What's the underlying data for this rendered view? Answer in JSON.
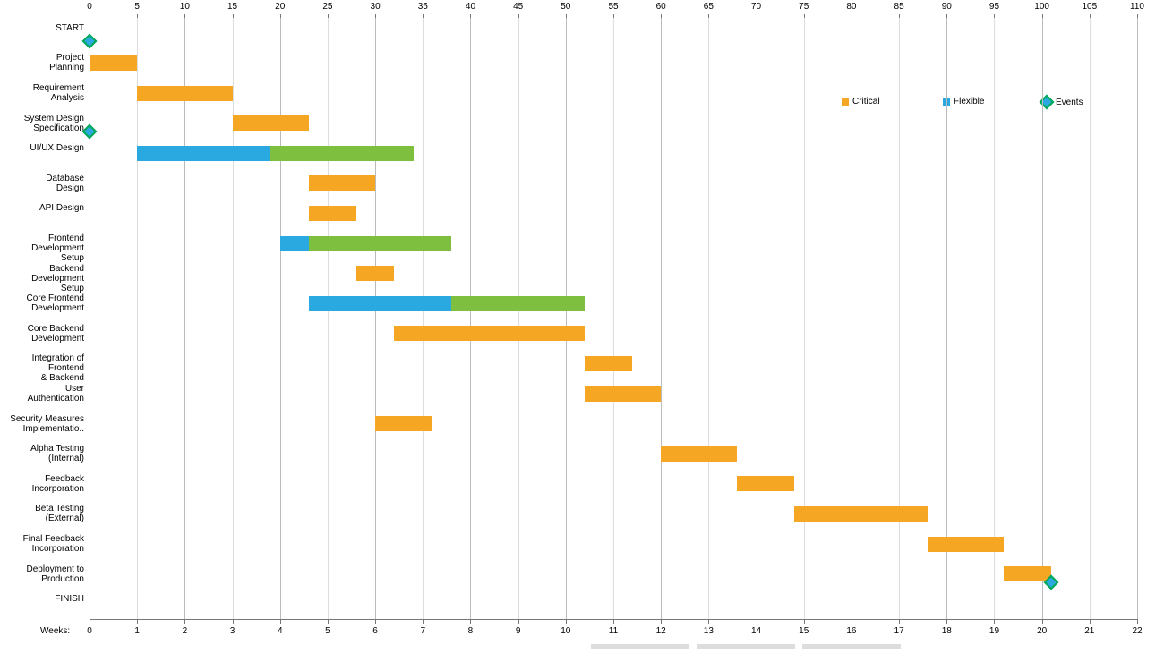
{
  "chart_data": {
    "type": "gantt",
    "top_axis": {
      "label_suffix": "",
      "min": 0,
      "max": 110,
      "step": 5
    },
    "bottom_axis": {
      "label": "Weeks:",
      "min": 0,
      "max": 22,
      "step": 1
    },
    "legend": [
      {
        "name": "Critical",
        "color": "#f5a623",
        "shape": "square"
      },
      {
        "name": "Flexible",
        "color": "#2aa9e0",
        "shape": "square"
      },
      {
        "name": "Events",
        "color": "#2aa9e0",
        "shape": "diamond"
      }
    ],
    "tasks": [
      {
        "label": "START",
        "segments": [],
        "events": [
          {
            "at": 0
          }
        ]
      },
      {
        "label": "Project Planning",
        "segments": [
          {
            "start": 0,
            "end": 5,
            "kind": "critical"
          }
        ]
      },
      {
        "label": "Requirement Analysis",
        "segments": [
          {
            "start": 5,
            "end": 15,
            "kind": "critical"
          }
        ]
      },
      {
        "label": "System Design Specification",
        "segments": [
          {
            "start": 15,
            "end": 23,
            "kind": "critical"
          }
        ],
        "events": [
          {
            "at": 0
          }
        ]
      },
      {
        "label": "UI/UX Design",
        "segments": [
          {
            "start": 5,
            "end": 19,
            "kind": "flexible"
          },
          {
            "start": 19,
            "end": 34,
            "kind": "slack"
          }
        ]
      },
      {
        "label": "Database Design",
        "segments": [
          {
            "start": 23,
            "end": 30,
            "kind": "critical"
          }
        ]
      },
      {
        "label": "API Design",
        "segments": [
          {
            "start": 23,
            "end": 28,
            "kind": "critical"
          }
        ]
      },
      {
        "label": "Frontend Development Setup",
        "segments": [
          {
            "start": 20,
            "end": 23,
            "kind": "flexible"
          },
          {
            "start": 23,
            "end": 38,
            "kind": "slack"
          }
        ]
      },
      {
        "label": "Backend Development Setup",
        "segments": [
          {
            "start": 28,
            "end": 32,
            "kind": "critical"
          }
        ]
      },
      {
        "label": "Core Frontend Development",
        "segments": [
          {
            "start": 23,
            "end": 38,
            "kind": "flexible"
          },
          {
            "start": 38,
            "end": 52,
            "kind": "slack"
          }
        ]
      },
      {
        "label": "Core Backend Development",
        "segments": [
          {
            "start": 32,
            "end": 52,
            "kind": "critical"
          }
        ]
      },
      {
        "label": "Integration of Frontend & Backend",
        "segments": [
          {
            "start": 52,
            "end": 57,
            "kind": "critical"
          }
        ]
      },
      {
        "label": "User Authentication",
        "segments": [
          {
            "start": 52,
            "end": 60,
            "kind": "critical"
          }
        ]
      },
      {
        "label": "Security Measures Implementation",
        "segments": [
          {
            "start": 30,
            "end": 36,
            "kind": "critical"
          }
        ]
      },
      {
        "label": "Alpha Testing (Internal)",
        "segments": [
          {
            "start": 60,
            "end": 68,
            "kind": "critical"
          }
        ]
      },
      {
        "label": "Feedback Incorporation",
        "segments": [
          {
            "start": 68,
            "end": 74,
            "kind": "critical"
          }
        ]
      },
      {
        "label": "Beta Testing (External)",
        "segments": [
          {
            "start": 74,
            "end": 88,
            "kind": "critical"
          }
        ]
      },
      {
        "label": "Final Feedback Incorporation",
        "segments": [
          {
            "start": 88,
            "end": 96,
            "kind": "critical"
          }
        ]
      },
      {
        "label": "Deployment to Production",
        "segments": [
          {
            "start": 96,
            "end": 101,
            "kind": "critical"
          }
        ],
        "events": [
          {
            "at": 101
          }
        ]
      },
      {
        "label": "FINISH",
        "segments": []
      }
    ]
  }
}
